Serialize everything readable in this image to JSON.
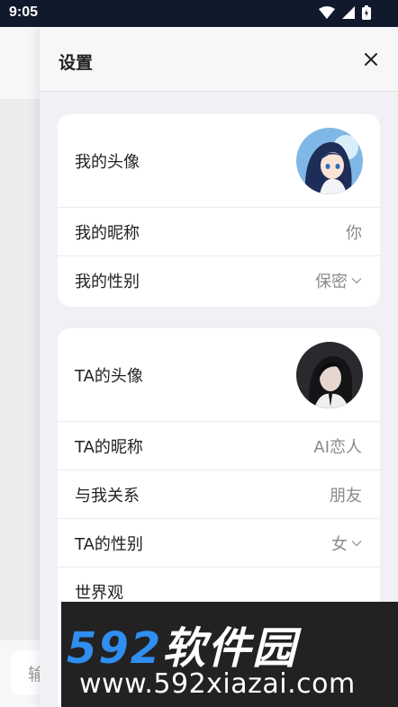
{
  "status_bar": {
    "time": "9:05"
  },
  "background": {
    "input_placeholder": "输"
  },
  "panel": {
    "title": "设置",
    "my_card": {
      "avatar_label": "我的头像",
      "nickname_label": "我的昵称",
      "nickname_value": "你",
      "gender_label": "我的性别",
      "gender_value": "保密"
    },
    "ta_card": {
      "avatar_label": "TA的头像",
      "nickname_label": "TA的昵称",
      "nickname_value": "AI恋人",
      "relation_label": "与我关系",
      "relation_value": "朋友",
      "gender_label": "TA的性别",
      "gender_value": "女",
      "worldview_label": "世界观"
    }
  },
  "watermark": {
    "brand_num": "592",
    "brand_cn": "软件园",
    "url": "www.592xiazai.com"
  },
  "colors": {
    "status_bar": "#111a2c",
    "watermark_blue": "#2f8ef0"
  }
}
